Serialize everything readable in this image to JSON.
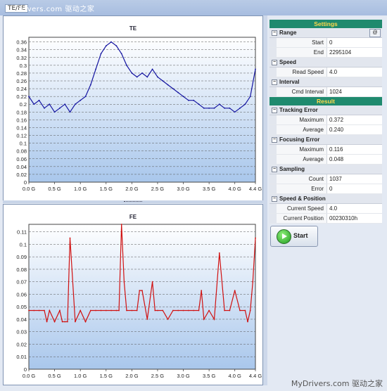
{
  "watermark_top": "drivers.com 驱动之家",
  "watermark_bottom": "MyDrivers.com 驱动之家",
  "tab_tag": "TE/FE",
  "charts": {
    "te_title": "TE",
    "fe_title": "FE"
  },
  "settings": {
    "header": "Settings",
    "groups": [
      {
        "name": "Range",
        "rows": [
          {
            "k": "Start",
            "v": "0"
          },
          {
            "k": "End",
            "v": "2295104"
          }
        ]
      },
      {
        "name": "Speed",
        "rows": [
          {
            "k": "Read Speed",
            "v": "4.0"
          }
        ]
      },
      {
        "name": "Interval",
        "rows": [
          {
            "k": "Cmd Interval",
            "v": "1024"
          }
        ]
      }
    ],
    "range_button": "@"
  },
  "result": {
    "header": "Result",
    "groups": [
      {
        "name": "Tracking Error",
        "rows": [
          {
            "k": "Maximum",
            "v": "0.372"
          },
          {
            "k": "Average",
            "v": "0.240"
          }
        ]
      },
      {
        "name": "Focusing Error",
        "rows": [
          {
            "k": "Maximum",
            "v": "0.116"
          },
          {
            "k": "Average",
            "v": "0.048"
          }
        ]
      },
      {
        "name": "Sampling",
        "rows": [
          {
            "k": "Count",
            "v": "1037"
          },
          {
            "k": "Error",
            "v": "0"
          }
        ]
      },
      {
        "name": "Speed & Position",
        "rows": [
          {
            "k": "Current Speed",
            "v": "4.0"
          },
          {
            "k": "Current Position",
            "v": "00230310h"
          }
        ]
      }
    ]
  },
  "start_button": "Start",
  "chart_data": [
    {
      "type": "line",
      "title": "TE",
      "color": "#1414a0",
      "x_ticks": [
        "0.0 G",
        "0.5 G",
        "1.0 G",
        "1.5 G",
        "2.0 G",
        "2.5 G",
        "3.0 G",
        "3.5 G",
        "4.0 G",
        "4.4 G"
      ],
      "y_ticks": [
        "0",
        "0.02",
        "0.04",
        "0.06",
        "0.08",
        "0.1",
        "0.12",
        "0.14",
        "0.16",
        "0.18",
        "0.2",
        "0.22",
        "0.24",
        "0.26",
        "0.28",
        "0.3",
        "0.32",
        "0.34",
        "0.36"
      ],
      "xlim": [
        0,
        4.4
      ],
      "ylim": [
        0,
        0.372
      ],
      "grid": true,
      "x": [
        0,
        0.1,
        0.2,
        0.3,
        0.4,
        0.5,
        0.6,
        0.7,
        0.8,
        0.9,
        1.0,
        1.1,
        1.2,
        1.3,
        1.4,
        1.5,
        1.6,
        1.7,
        1.8,
        1.9,
        2.0,
        2.1,
        2.2,
        2.3,
        2.4,
        2.5,
        2.6,
        2.7,
        2.8,
        2.9,
        3.0,
        3.1,
        3.2,
        3.3,
        3.4,
        3.5,
        3.6,
        3.7,
        3.8,
        3.9,
        4.0,
        4.1,
        4.2,
        4.3,
        4.4
      ],
      "values": [
        0.22,
        0.2,
        0.21,
        0.19,
        0.2,
        0.18,
        0.19,
        0.2,
        0.18,
        0.2,
        0.21,
        0.22,
        0.25,
        0.29,
        0.33,
        0.35,
        0.36,
        0.35,
        0.33,
        0.3,
        0.28,
        0.27,
        0.28,
        0.27,
        0.29,
        0.27,
        0.26,
        0.25,
        0.24,
        0.23,
        0.22,
        0.21,
        0.21,
        0.2,
        0.19,
        0.19,
        0.19,
        0.2,
        0.19,
        0.19,
        0.18,
        0.19,
        0.2,
        0.22,
        0.29
      ]
    },
    {
      "type": "line",
      "title": "FE",
      "color": "#d01010",
      "x_ticks": [
        "0.0 G",
        "0.5 G",
        "1.0 G",
        "1.5 G",
        "2.0 G",
        "2.5 G",
        "3.0 G",
        "3.5 G",
        "4.0 G",
        "4.4 G"
      ],
      "y_ticks": [
        "0",
        "0.01",
        "0.02",
        "0.03",
        "0.04",
        "0.05",
        "0.06",
        "0.07",
        "0.08",
        "0.09",
        "0.1",
        "0.11"
      ],
      "xlim": [
        0,
        4.4
      ],
      "ylim": [
        0,
        0.116
      ],
      "grid": true,
      "x": [
        0,
        0.1,
        0.2,
        0.3,
        0.35,
        0.4,
        0.5,
        0.6,
        0.65,
        0.7,
        0.75,
        0.8,
        0.9,
        1.0,
        1.1,
        1.2,
        1.3,
        1.4,
        1.5,
        1.6,
        1.7,
        1.75,
        1.8,
        1.85,
        1.9,
        2.0,
        2.1,
        2.15,
        2.2,
        2.3,
        2.4,
        2.45,
        2.5,
        2.6,
        2.7,
        2.8,
        2.9,
        3.0,
        3.1,
        3.2,
        3.3,
        3.35,
        3.4,
        3.5,
        3.6,
        3.7,
        3.8,
        3.9,
        4.0,
        4.1,
        4.2,
        4.25,
        4.3,
        4.35,
        4.4
      ],
      "values": [
        0.047,
        0.047,
        0.047,
        0.047,
        0.038,
        0.047,
        0.038,
        0.047,
        0.038,
        0.038,
        0.038,
        0.105,
        0.038,
        0.047,
        0.038,
        0.047,
        0.047,
        0.047,
        0.047,
        0.047,
        0.047,
        0.047,
        0.116,
        0.07,
        0.047,
        0.047,
        0.047,
        0.063,
        0.063,
        0.04,
        0.07,
        0.047,
        0.047,
        0.047,
        0.04,
        0.047,
        0.047,
        0.047,
        0.047,
        0.047,
        0.047,
        0.063,
        0.04,
        0.047,
        0.04,
        0.093,
        0.047,
        0.047,
        0.063,
        0.047,
        0.047,
        0.038,
        0.047,
        0.07,
        0.105
      ]
    }
  ]
}
